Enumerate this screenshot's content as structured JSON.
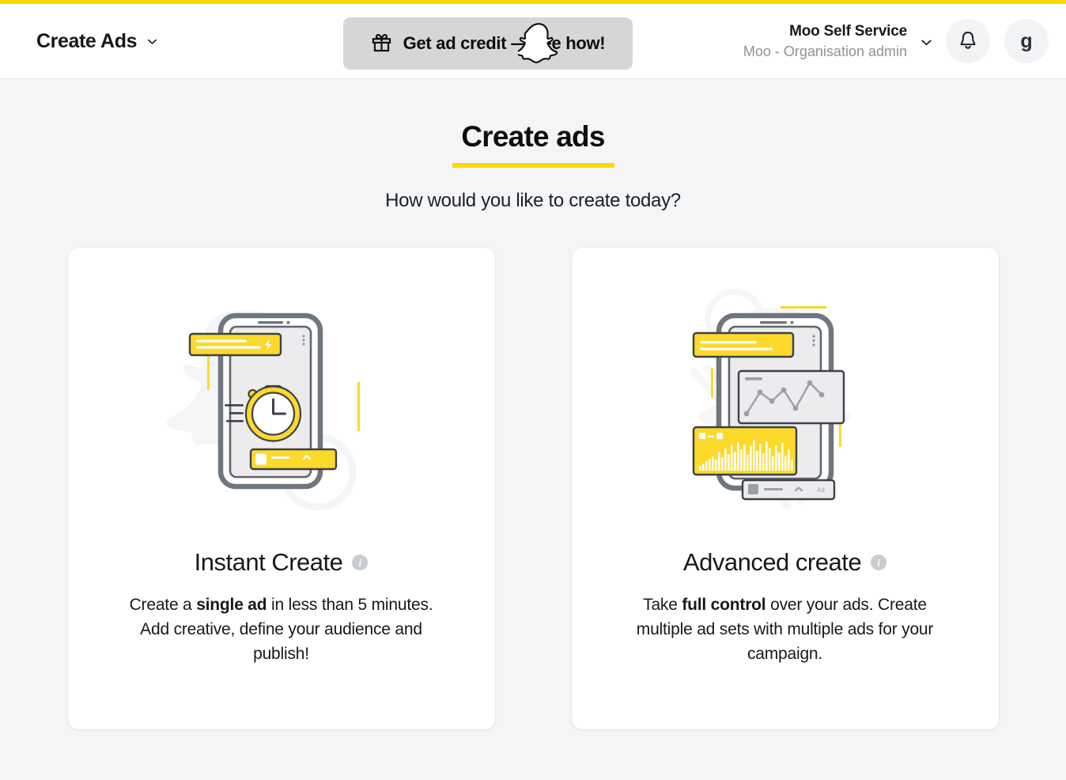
{
  "header": {
    "accent_color": "#FFD800",
    "brand_label": "Create Ads",
    "brand_chevron_icon": "chevron-down-icon",
    "credit_button": {
      "gift_icon": "gift-icon",
      "label": "Get ad credit — see how!",
      "ghost_icon": "snapchat-ghost-icon",
      "background": "#d4d6d8"
    },
    "account": {
      "name": "Moo Self Service",
      "role": "Moo - Organisation admin",
      "chevron_icon": "chevron-down-icon",
      "notifications_icon": "bell-icon",
      "avatar_letter": "g"
    }
  },
  "main": {
    "title": "Create ads",
    "title_underline_color": "#FFD800",
    "subtitle": "How would you like to create today?",
    "cards": [
      {
        "id": "instant-create",
        "illustration": "phone-stopwatch-illustration",
        "title": "Instant Create",
        "info_icon": "info-icon",
        "desc_parts": [
          {
            "text": "Create a ",
            "bold": false
          },
          {
            "text": "single ad",
            "bold": true
          },
          {
            "text": " in less than 5 minutes. Add creative, define your audience and publish!",
            "bold": false
          }
        ]
      },
      {
        "id": "advanced-create",
        "illustration": "phone-analytics-illustration",
        "title": "Advanced create",
        "info_icon": "info-icon",
        "desc_parts": [
          {
            "text": "Take ",
            "bold": false
          },
          {
            "text": "full control",
            "bold": true
          },
          {
            "text": " over your ads. Create multiple ad sets with multiple ads for your campaign.",
            "bold": false
          }
        ]
      }
    ]
  },
  "colors": {
    "brand_yellow": "#FFD800",
    "illustration_yellow": "#FCD92B",
    "illustration_grey": "#6F767D",
    "page_background": "#f4f5f7",
    "card_background": "#ffffff"
  }
}
